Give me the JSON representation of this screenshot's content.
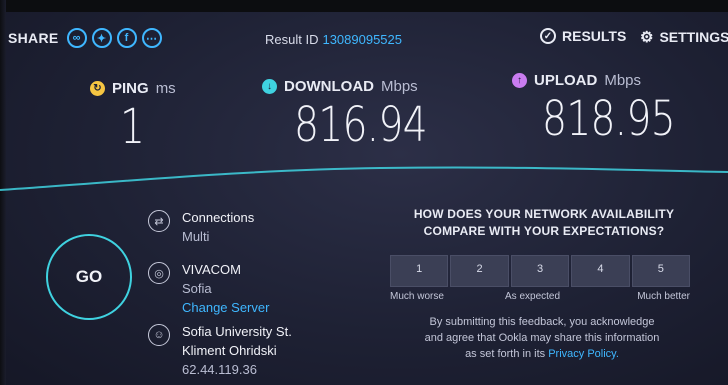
{
  "header": {
    "share_label": "SHARE",
    "share_icons": [
      "link-icon",
      "twitter-icon",
      "facebook-icon",
      "more-icon"
    ],
    "result_label": "Result ID",
    "result_id": "13089095525",
    "results_label": "RESULTS",
    "settings_label": "SETTINGS"
  },
  "metrics": {
    "ping": {
      "label": "PING",
      "unit": "ms",
      "value": "1",
      "color": "#f5c542"
    },
    "download": {
      "label": "DOWNLOAD",
      "unit": "Mbps",
      "value": "816.94",
      "color": "#3fd2e0"
    },
    "upload": {
      "label": "UPLOAD",
      "unit": "Mbps",
      "value": "818.95",
      "color": "#c97cf0"
    }
  },
  "go_label": "GO",
  "connection": {
    "title": "Connections",
    "mode": "Multi",
    "isp": "VIVACOM",
    "city": "Sofia",
    "change_server": "Change Server",
    "host_line1": "Sofia University St.",
    "host_line2": "Kliment Ohridski",
    "ip": "62.44.119.36"
  },
  "survey": {
    "title_line1": "HOW DOES YOUR NETWORK AVAILABILITY",
    "title_line2": "COMPARE WITH YOUR EXPECTATIONS?",
    "options": [
      "1",
      "2",
      "3",
      "4",
      "5"
    ],
    "label_low": "Much worse",
    "label_mid": "As expected",
    "label_high": "Much better",
    "disclaimer_line1": "By submitting this feedback, you acknowledge",
    "disclaimer_line2": "and agree that Ookla may share this information",
    "disclaimer_line3": "as set forth in its",
    "privacy_link": "Privacy Policy."
  }
}
